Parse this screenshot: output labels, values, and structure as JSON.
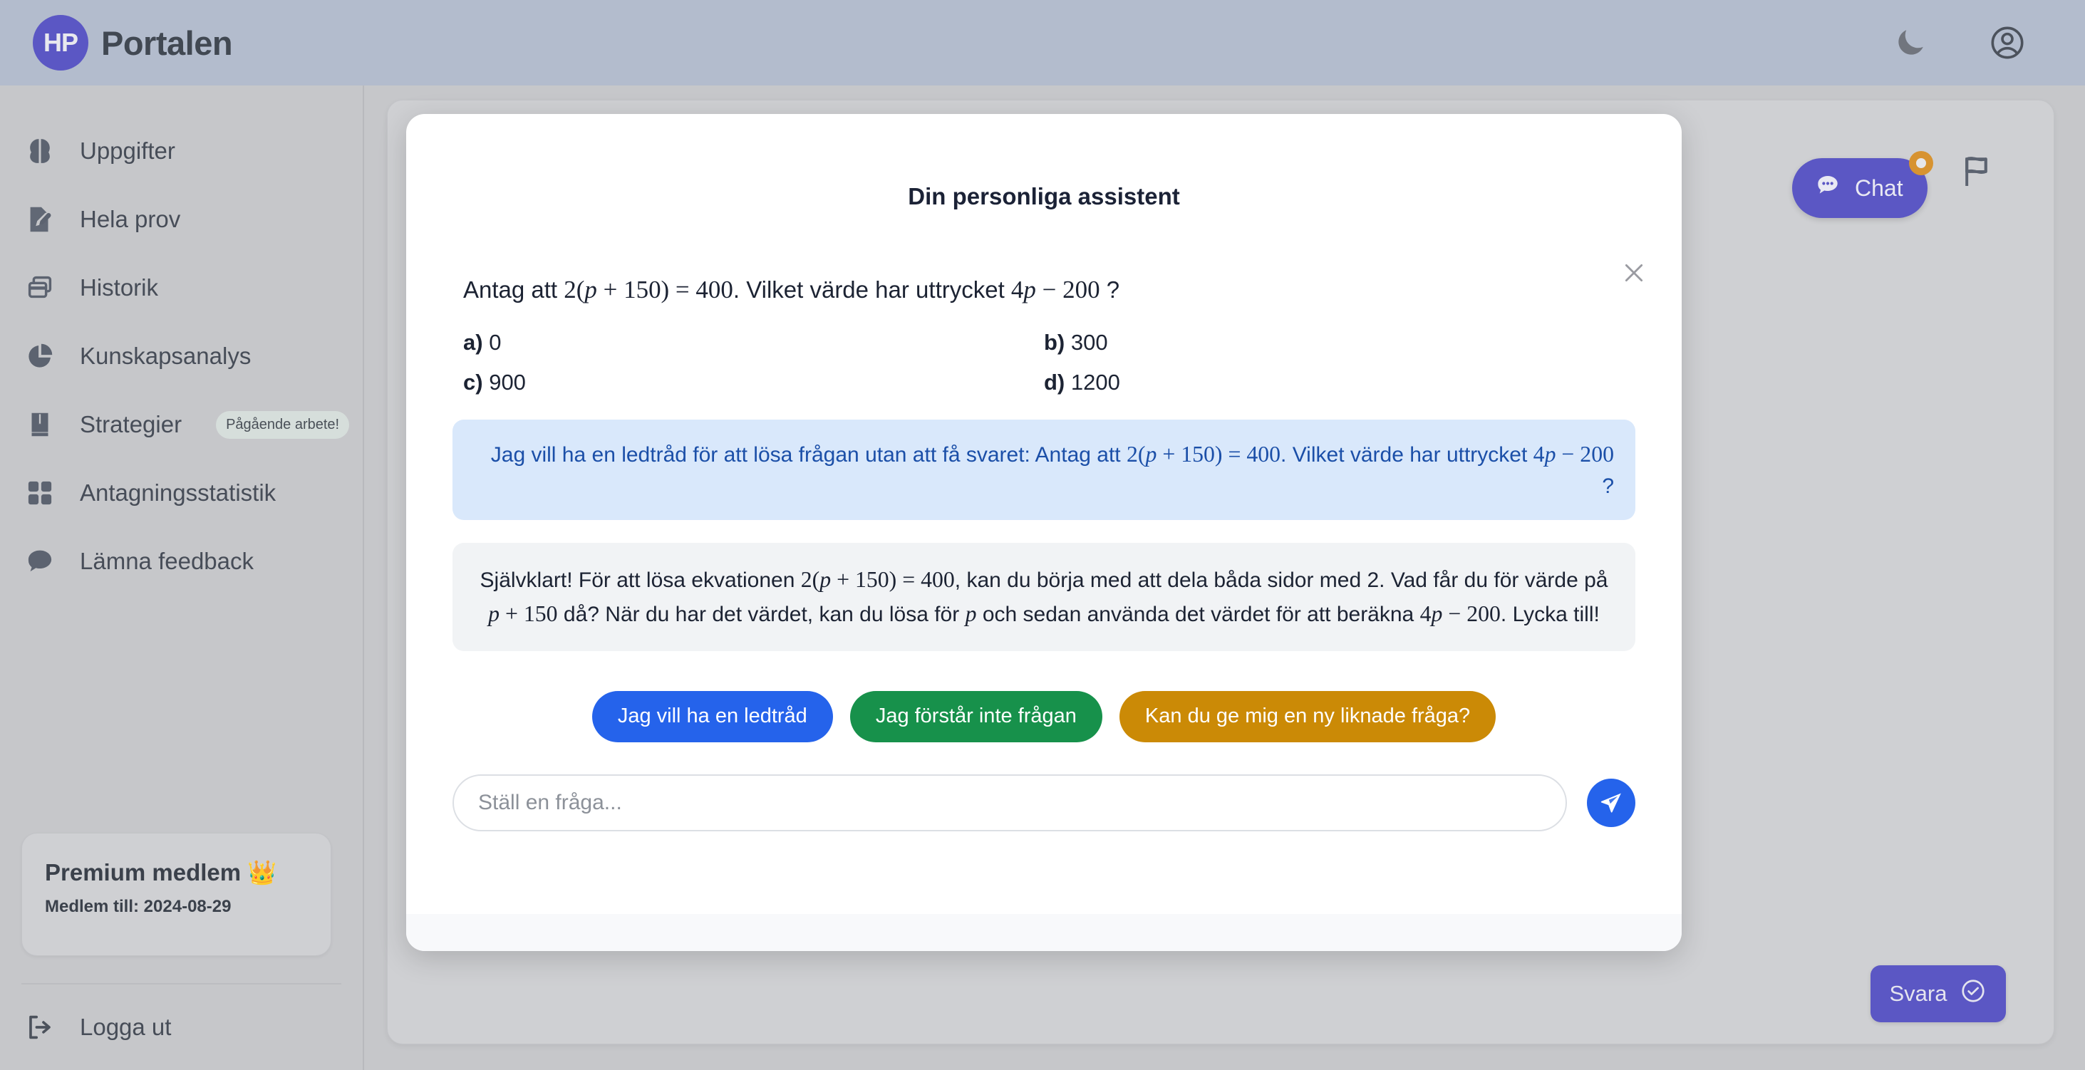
{
  "topbar": {
    "logo_text": "HP",
    "brand": "Portalen",
    "dark_mode_icon": "moon-icon",
    "profile_icon": "user-circle-icon"
  },
  "sidebar": {
    "items": [
      {
        "label": "Uppgifter",
        "icon": "brain-icon"
      },
      {
        "label": "Hela prov",
        "icon": "document-pencil-icon"
      },
      {
        "label": "Historik",
        "icon": "window-stack-icon"
      },
      {
        "label": "Kunskapsanalys",
        "icon": "pie-chart-icon"
      },
      {
        "label": "Strategier",
        "icon": "book-icon",
        "badge": "Pågående arbete!"
      },
      {
        "label": "Antagningsstatistik",
        "icon": "grid-icon"
      },
      {
        "label": "Lämna feedback",
        "icon": "chat-bubble-icon"
      }
    ],
    "premium": {
      "title": "Premium medlem 👑",
      "subtitle": "Medlem till: 2024-08-29"
    },
    "logout": {
      "label": "Logga ut",
      "icon": "logout-icon"
    }
  },
  "main": {
    "chat_fab": {
      "label": "Chat",
      "icon": "chat-dots-icon",
      "has_notification": true
    },
    "flag_button": {
      "icon": "flag-icon"
    },
    "answer_button": {
      "label": "Svara",
      "icon": "check-circle-icon"
    }
  },
  "modal": {
    "title": "Din personliga assistent",
    "close_icon": "close-icon",
    "question": {
      "prefix": "Antag att ",
      "eq_a": "2(",
      "eq_var": "p",
      "eq_b": " + 150) = 400",
      "mid": ". Vilket värde har uttrycket ",
      "expr_a": "4",
      "expr_var": "p",
      "expr_b": " − 200",
      "suffix": " ?"
    },
    "options": [
      {
        "letter": "a)",
        "value": "0"
      },
      {
        "letter": "b)",
        "value": "300"
      },
      {
        "letter": "c)",
        "value": "900"
      },
      {
        "letter": "d)",
        "value": "1200"
      }
    ],
    "user_message": {
      "text_1": "Jag vill ha en ledtråd för att lösa frågan utan att få svaret: Antag att ",
      "m_1": "2(",
      "m_1v": "p",
      "m_1b": " + 150) = 400",
      "text_2": ". Vilket värde har uttrycket ",
      "m_2": "4",
      "m_2v": "p",
      "m_2b": " − 200",
      "text_3": " ?"
    },
    "bot_message": {
      "text_1": "Självklart! För att lösa ekvationen ",
      "m_1": "2(",
      "m_1v": "p",
      "m_1b": " + 150) = 400",
      "text_2": ", kan du börja med att dela båda sidor med 2. Vad får du för värde på ",
      "m_2v": "p",
      "m_2b": " + 150",
      "text_3": " då? När du har det värdet, kan du lösa för ",
      "m_3v": "p",
      "text_4": " och sedan använda det värdet för att beräkna ",
      "m_4": "4",
      "m_4v": "p",
      "m_4b": " − 200",
      "text_5": ". Lycka till!"
    },
    "quick_replies": [
      {
        "label": "Jag vill ha en ledtråd",
        "color": "#2563eb"
      },
      {
        "label": "Jag förstår inte frågan",
        "color": "#17914b"
      },
      {
        "label": "Kan du ge mig en ny liknade fråga?",
        "color": "#cb8a06"
      }
    ],
    "composer": {
      "placeholder": "Ställ en fråga...",
      "value": "",
      "send_icon": "send-icon"
    }
  },
  "colors": {
    "brand_purple": "#5b57c4",
    "topbar": "#b3bccd",
    "page_bg": "#c6c7ca",
    "user_bubble": "#d9e8fb",
    "user_text": "#1b4fa8",
    "bot_bubble": "#f1f3f5",
    "notification_dot": "#d79331"
  }
}
